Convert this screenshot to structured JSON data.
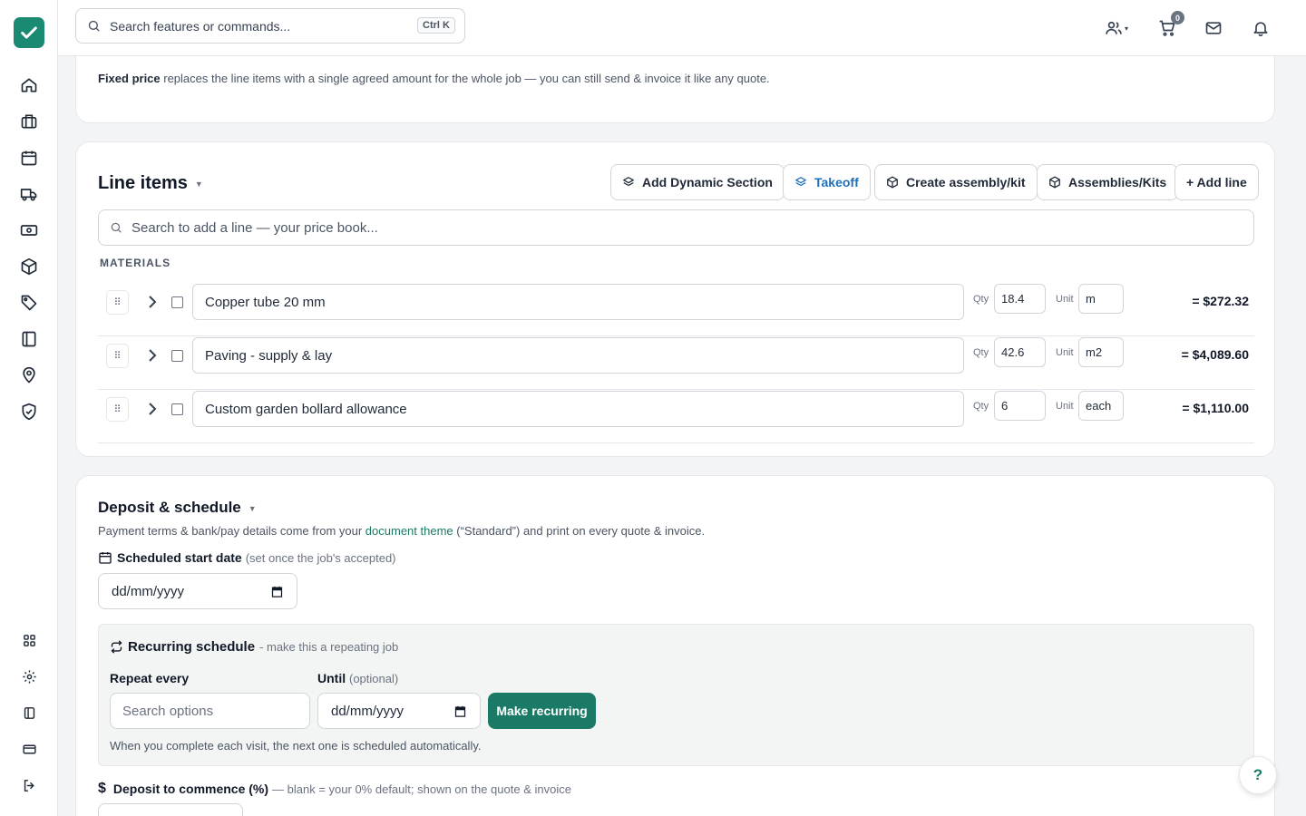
{
  "topbar": {
    "search_placeholder": "Search features or commands...",
    "shortcut": "Ctrl K",
    "cart_count": "0"
  },
  "fixed_price": {
    "label": "Fixed price",
    "note": " replaces the line items with a single agreed amount for the whole job — you can still send & invoice it like any quote."
  },
  "line_items": {
    "title": "Line items",
    "buttons": {
      "dynamic_section": "Add Dynamic Section",
      "takeoff": "Takeoff",
      "create_assembly": "Create assembly/kit",
      "assemblies": "Assemblies/Kits",
      "add_line": "+ Add line"
    },
    "search_placeholder": "Search to add a line — your price book...",
    "group_label": "MATERIALS",
    "qty_label": "Qty",
    "unit_label": "Unit",
    "rows": [
      {
        "description": "Copper tube 20 mm",
        "qty": "18.4",
        "unit": "m",
        "total": "= $272.32"
      },
      {
        "description": "Paving - supply & lay",
        "qty": "42.6",
        "unit": "m2",
        "total": "= $4,089.60"
      },
      {
        "description": "Custom garden bollard allowance",
        "qty": "6",
        "unit": "each",
        "total": "= $1,110.00"
      }
    ]
  },
  "deposit": {
    "title": "Deposit & schedule",
    "note_before": "Payment terms & bank/pay details come from your ",
    "note_link": "document theme",
    "note_after": " (“Standard”) and print on every quote & invoice.",
    "start_label": "Scheduled start date",
    "start_hint": "(set once the job's accepted)",
    "date_placeholder": "dd/mm/yyyy",
    "recurring": {
      "title": "Recurring schedule",
      "subtitle": "- make this a repeating job",
      "repeat_label": "Repeat every",
      "until_label": "Until",
      "until_hint": "(optional)",
      "options_placeholder": "Search options",
      "date_placeholder": "dd/mm/yyyy",
      "button": "Make recurring",
      "help": "When you complete each visit, the next one is scheduled automatically."
    },
    "deposit_label": "Deposit to commence (%)",
    "deposit_hint": "— blank = your 0% default; shown on the quote & invoice"
  },
  "help_fab": "?",
  "colors": {
    "brand": "#1a8a72",
    "accent": "#1a7a66",
    "takeoff": "#1d6fb8"
  }
}
